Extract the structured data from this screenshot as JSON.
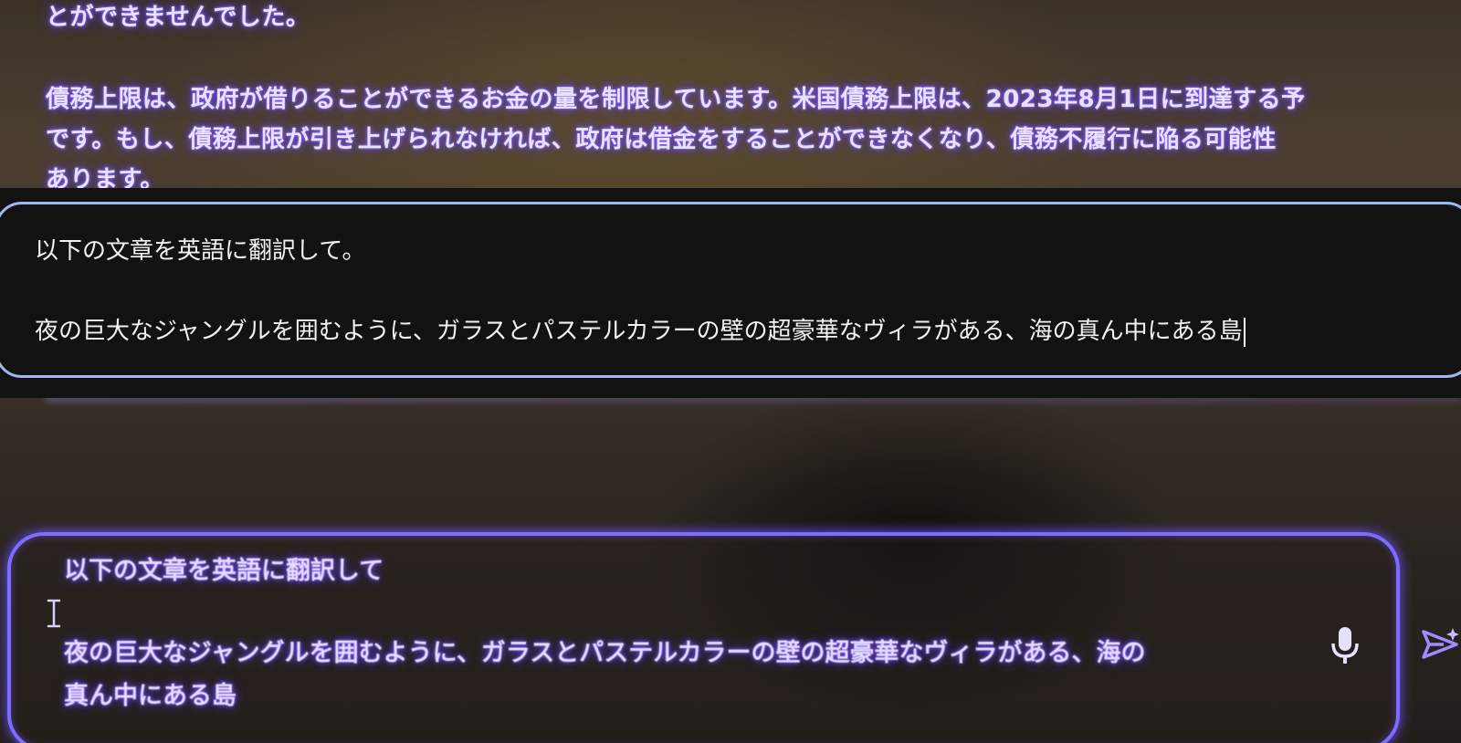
{
  "response": {
    "lines": [
      "とができませんでした。",
      "債務上限は、政府が借りることができるお金の量を制限しています。米国債務上限は、2023年8月1日に到達する予",
      "です。もし、債務上限が引き上げられなければ、政府は借金をすることができなくなり、債務不履行に陥る可能性",
      "あります。"
    ]
  },
  "overlay": {
    "line1": "以下の文章を英語に翻訳して。",
    "line2": "夜の巨大なジャングルを囲むように、ガラスとパステルカラーの壁の超豪華なヴィラがある、海の真ん中にある島"
  },
  "input": {
    "line1": "以下の文章を英語に翻訳して",
    "line2": "夜の巨大なジャングルを囲むように、ガラスとパステルカラーの壁の超豪華なヴィラがある、海の",
    "line3": "真ん中にある島"
  },
  "icons": {
    "mic": "microphone-icon",
    "send": "send-icon",
    "cursor": "text-cursor-icon"
  },
  "colors": {
    "glow": "#7a52ff",
    "overlay_border": "#9fb8f0",
    "input_border": "#7d6cff"
  }
}
